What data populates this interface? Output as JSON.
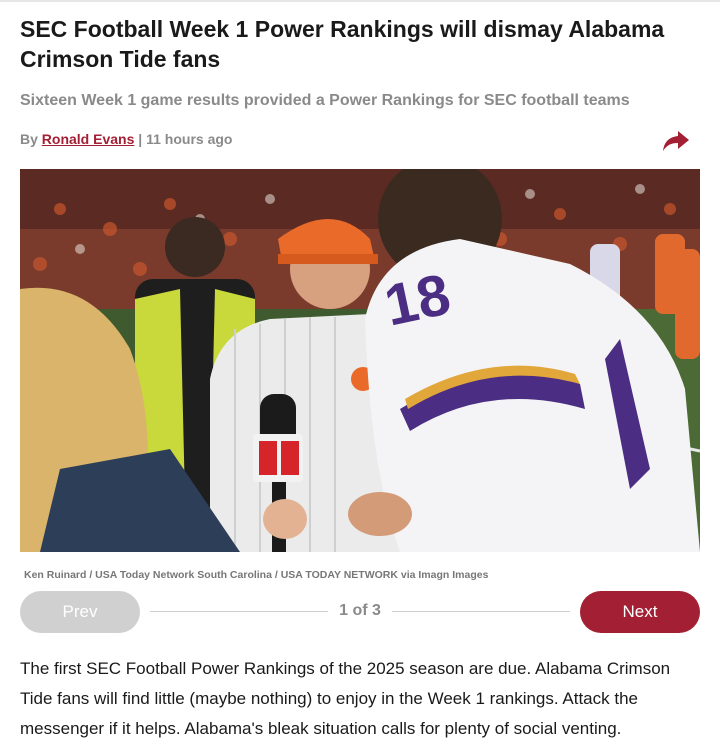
{
  "article": {
    "headline": "SEC Football Week 1 Power Rankings will dismay Alabama Crimson Tide fans",
    "subhead": "Sixteen Week 1 game results provided a Power Rankings for SEC football teams",
    "byline_prefix": "By",
    "author": "Ronald Evans",
    "byline_separator": "|",
    "time_ago": "11 hours ago",
    "share_icon": "share-arrow-icon",
    "photo": {
      "jersey_number": "18",
      "caption": "Ken Ruinard / USA Today Network South Carolina / USA TODAY NETWORK via Imagn Images"
    },
    "body": "The first SEC Football Power Rankings of the 2025 season are due. Alabama Crimson Tide fans will find little (maybe nothing) to enjoy in the Week 1 rankings. Attack the messenger if it helps. Alabama's bleak situation calls for plenty of social venting."
  },
  "gallery": {
    "prev_label": "Prev",
    "next_label": "Next",
    "counter": "1 of 3"
  },
  "colors": {
    "brand": "#a31f34",
    "muted": "#8a8a8a",
    "disabled": "#d0d0d0"
  }
}
